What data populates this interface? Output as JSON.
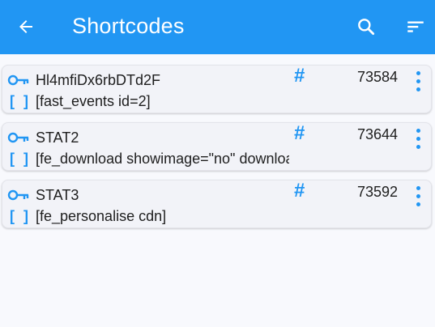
{
  "appbar": {
    "title": "Shortcodes",
    "back_icon": "arrow-left-icon",
    "search_icon": "search-icon",
    "sort_icon": "sort-icon",
    "bg_color": "#2196f3"
  },
  "items": [
    {
      "name": "Hl4mfiDx6rbDTd2F",
      "count": "73584",
      "hash": "#",
      "bracket": "[ ]",
      "code": "[fast_events id=2]"
    },
    {
      "name": "STAT2",
      "count": "73644",
      "hash": "#",
      "bracket": "[ ]",
      "code": "[fe_download showimage=\"no\" download"
    },
    {
      "name": "STAT3",
      "count": "73592",
      "hash": "#",
      "bracket": "[ ]",
      "code": "[fe_personalise cdn]"
    }
  ],
  "accent_color": "#2196f3"
}
